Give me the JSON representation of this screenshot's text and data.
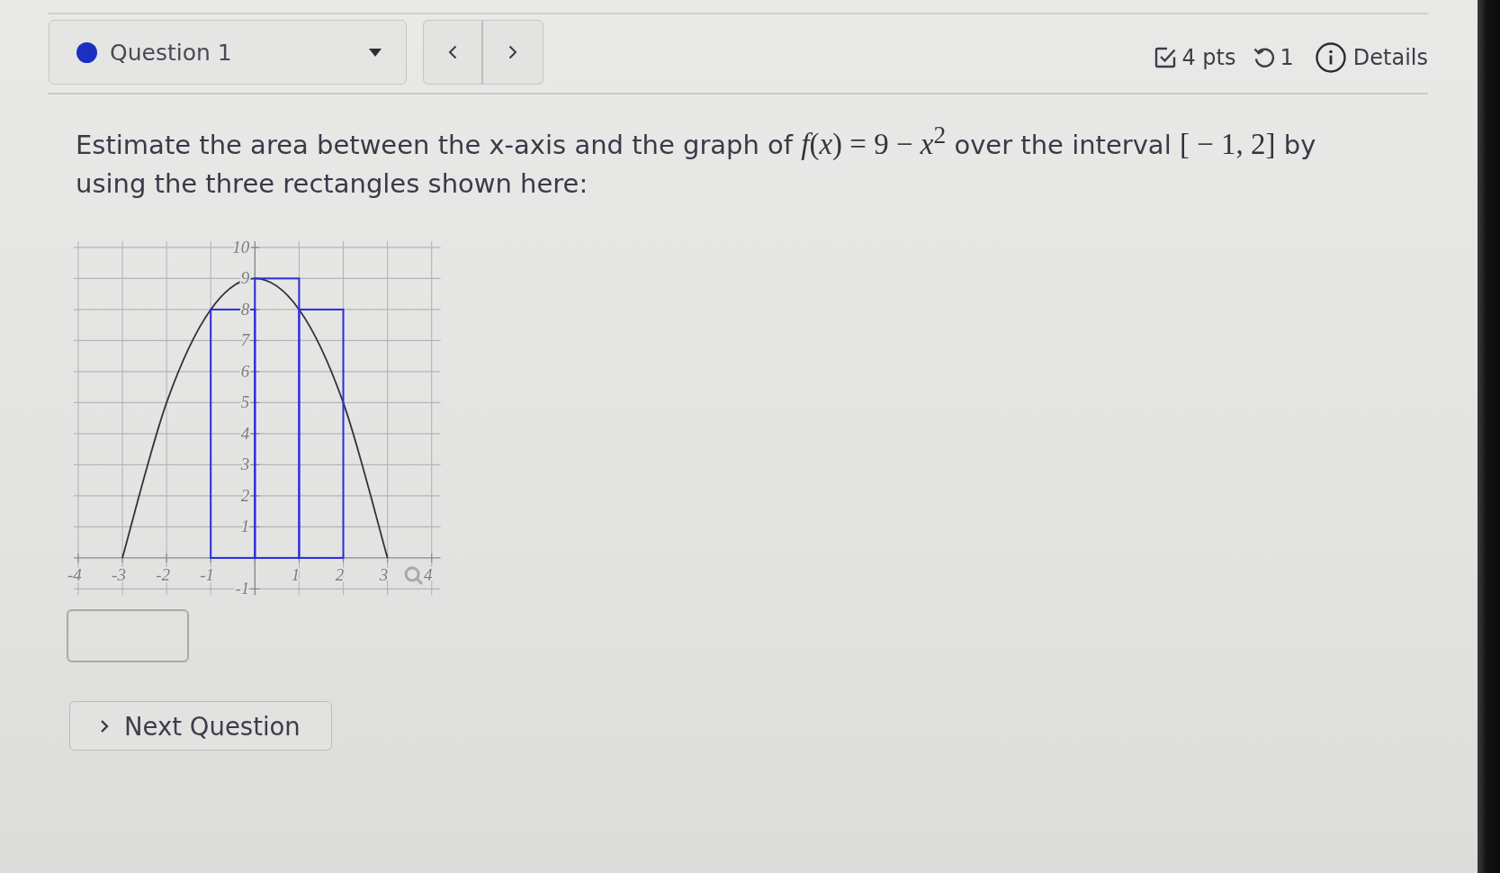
{
  "header": {
    "question_selector": {
      "label": "Question 1"
    },
    "points": "4 pts",
    "attempts": "1",
    "details_link": "Details"
  },
  "question": {
    "parts": [
      {
        "kind": "text",
        "text": "Estimate the area between the x-axis and the graph of "
      },
      {
        "kind": "math",
        "text": "*f*(*x*) = 9 − *x*$^{2}$"
      },
      {
        "kind": "text",
        "text": " over the interval "
      },
      {
        "kind": "math",
        "text": "[ − 1, 2]"
      },
      {
        "kind": "text",
        "text": " by using the three rectangles shown here:"
      }
    ],
    "chart_data": [
      {
        "type": "bar",
        "grid": true,
        "xlim": [
          -4.1,
          4.2
        ],
        "ylim": [
          -1.2,
          10.2
        ],
        "xticks": [
          -4,
          -3,
          -2,
          -1,
          1,
          2,
          3,
          4
        ],
        "yticks": [
          -1,
          1,
          2,
          3,
          4,
          5,
          6,
          7,
          8,
          9,
          10
        ],
        "series": [
          {
            "type": "line",
            "color": "#333338",
            "x": [
              -3,
              -2,
              -1,
              0,
              1,
              2,
              3
            ],
            "values": [
              0,
              5,
              8,
              9,
              8,
              5,
              0
            ]
          },
          {
            "type": "bar",
            "color": "#2c2ce0",
            "x": [
              -0.5,
              0.5,
              1.5
            ],
            "values": [
              8,
              9,
              8
            ]
          }
        ]
      }
    ]
  },
  "next_button": {
    "label": "Next Question"
  }
}
